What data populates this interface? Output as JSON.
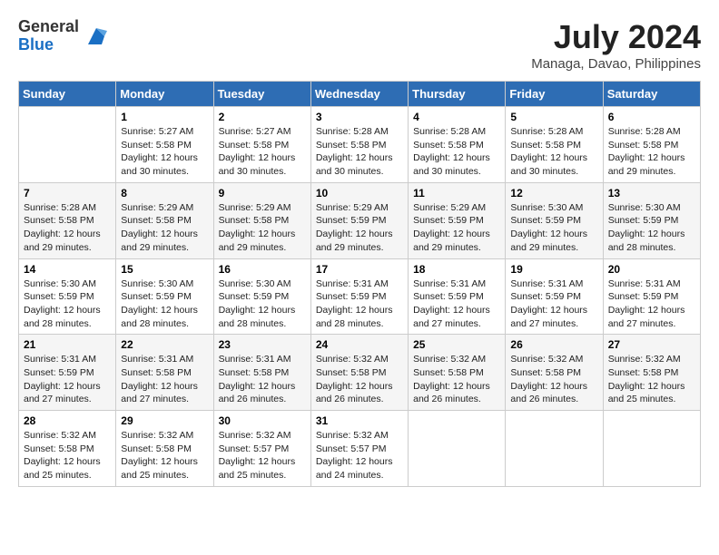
{
  "header": {
    "logo_general": "General",
    "logo_blue": "Blue",
    "month_year": "July 2024",
    "location": "Managa, Davao, Philippines"
  },
  "weekdays": [
    "Sunday",
    "Monday",
    "Tuesday",
    "Wednesday",
    "Thursday",
    "Friday",
    "Saturday"
  ],
  "weeks": [
    [
      {
        "day": "",
        "info": ""
      },
      {
        "day": "1",
        "info": "Sunrise: 5:27 AM\nSunset: 5:58 PM\nDaylight: 12 hours\nand 30 minutes."
      },
      {
        "day": "2",
        "info": "Sunrise: 5:27 AM\nSunset: 5:58 PM\nDaylight: 12 hours\nand 30 minutes."
      },
      {
        "day": "3",
        "info": "Sunrise: 5:28 AM\nSunset: 5:58 PM\nDaylight: 12 hours\nand 30 minutes."
      },
      {
        "day": "4",
        "info": "Sunrise: 5:28 AM\nSunset: 5:58 PM\nDaylight: 12 hours\nand 30 minutes."
      },
      {
        "day": "5",
        "info": "Sunrise: 5:28 AM\nSunset: 5:58 PM\nDaylight: 12 hours\nand 30 minutes."
      },
      {
        "day": "6",
        "info": "Sunrise: 5:28 AM\nSunset: 5:58 PM\nDaylight: 12 hours\nand 29 minutes."
      }
    ],
    [
      {
        "day": "7",
        "info": ""
      },
      {
        "day": "8",
        "info": "Sunrise: 5:29 AM\nSunset: 5:58 PM\nDaylight: 12 hours\nand 29 minutes."
      },
      {
        "day": "9",
        "info": "Sunrise: 5:29 AM\nSunset: 5:58 PM\nDaylight: 12 hours\nand 29 minutes."
      },
      {
        "day": "10",
        "info": "Sunrise: 5:29 AM\nSunset: 5:59 PM\nDaylight: 12 hours\nand 29 minutes."
      },
      {
        "day": "11",
        "info": "Sunrise: 5:29 AM\nSunset: 5:59 PM\nDaylight: 12 hours\nand 29 minutes."
      },
      {
        "day": "12",
        "info": "Sunrise: 5:30 AM\nSunset: 5:59 PM\nDaylight: 12 hours\nand 29 minutes."
      },
      {
        "day": "13",
        "info": "Sunrise: 5:30 AM\nSunset: 5:59 PM\nDaylight: 12 hours\nand 28 minutes."
      }
    ],
    [
      {
        "day": "14",
        "info": ""
      },
      {
        "day": "15",
        "info": "Sunrise: 5:30 AM\nSunset: 5:59 PM\nDaylight: 12 hours\nand 28 minutes."
      },
      {
        "day": "16",
        "info": "Sunrise: 5:30 AM\nSunset: 5:59 PM\nDaylight: 12 hours\nand 28 minutes."
      },
      {
        "day": "17",
        "info": "Sunrise: 5:31 AM\nSunset: 5:59 PM\nDaylight: 12 hours\nand 28 minutes."
      },
      {
        "day": "18",
        "info": "Sunrise: 5:31 AM\nSunset: 5:59 PM\nDaylight: 12 hours\nand 27 minutes."
      },
      {
        "day": "19",
        "info": "Sunrise: 5:31 AM\nSunset: 5:59 PM\nDaylight: 12 hours\nand 27 minutes."
      },
      {
        "day": "20",
        "info": "Sunrise: 5:31 AM\nSunset: 5:59 PM\nDaylight: 12 hours\nand 27 minutes."
      }
    ],
    [
      {
        "day": "21",
        "info": ""
      },
      {
        "day": "22",
        "info": "Sunrise: 5:31 AM\nSunset: 5:58 PM\nDaylight: 12 hours\nand 27 minutes."
      },
      {
        "day": "23",
        "info": "Sunrise: 5:31 AM\nSunset: 5:58 PM\nDaylight: 12 hours\nand 26 minutes."
      },
      {
        "day": "24",
        "info": "Sunrise: 5:32 AM\nSunset: 5:58 PM\nDaylight: 12 hours\nand 26 minutes."
      },
      {
        "day": "25",
        "info": "Sunrise: 5:32 AM\nSunset: 5:58 PM\nDaylight: 12 hours\nand 26 minutes."
      },
      {
        "day": "26",
        "info": "Sunrise: 5:32 AM\nSunset: 5:58 PM\nDaylight: 12 hours\nand 26 minutes."
      },
      {
        "day": "27",
        "info": "Sunrise: 5:32 AM\nSunset: 5:58 PM\nDaylight: 12 hours\nand 25 minutes."
      }
    ],
    [
      {
        "day": "28",
        "info": "Sunrise: 5:32 AM\nSunset: 5:58 PM\nDaylight: 12 hours\nand 25 minutes."
      },
      {
        "day": "29",
        "info": "Sunrise: 5:32 AM\nSunset: 5:58 PM\nDaylight: 12 hours\nand 25 minutes."
      },
      {
        "day": "30",
        "info": "Sunrise: 5:32 AM\nSunset: 5:57 PM\nDaylight: 12 hours\nand 25 minutes."
      },
      {
        "day": "31",
        "info": "Sunrise: 5:32 AM\nSunset: 5:57 PM\nDaylight: 12 hours\nand 24 minutes."
      },
      {
        "day": "",
        "info": ""
      },
      {
        "day": "",
        "info": ""
      },
      {
        "day": "",
        "info": ""
      }
    ]
  ],
  "week7_info": {
    "7": "Sunrise: 5:28 AM\nSunset: 5:58 PM\nDaylight: 12 hours\nand 29 minutes.",
    "14": "Sunrise: 5:30 AM\nSunset: 5:59 PM\nDaylight: 12 hours\nand 28 minutes.",
    "21": "Sunrise: 5:31 AM\nSunset: 5:59 PM\nDaylight: 12 hours\nand 27 minutes."
  }
}
